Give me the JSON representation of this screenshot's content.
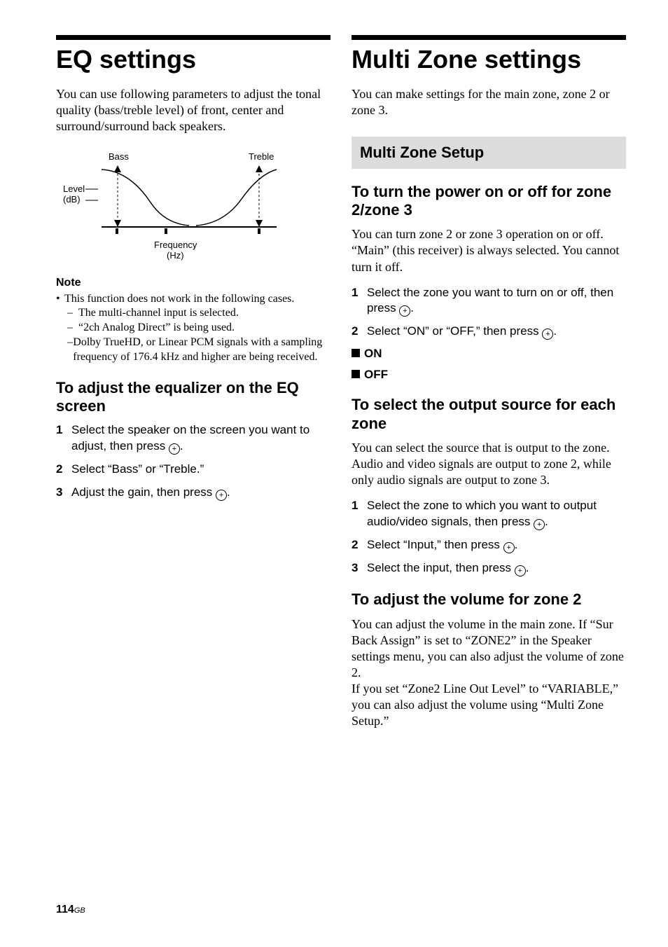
{
  "left": {
    "title": "EQ settings",
    "intro": "You can use following parameters to adjust the tonal quality (bass/treble level) of front, center and surround/surround back speakers.",
    "diagram": {
      "bass": "Bass",
      "treble": "Treble",
      "level": "Level",
      "db": "(dB)",
      "freq": "Frequency",
      "hz": "(Hz)"
    },
    "note_label": "Note",
    "note_bullet": "This function does not work in the following cases.",
    "note_items": [
      "The multi-channel input is selected.",
      "“2ch Analog Direct” is being used.",
      "Dolby TrueHD, or Linear PCM signals with a sampling frequency of 176.4 kHz and higher are being received."
    ],
    "adjust_heading": "To adjust the equalizer on the EQ screen",
    "steps": [
      {
        "pre": "Select the speaker on the screen you want to adjust, then press ",
        "post": "."
      },
      {
        "pre": "Select “Bass” or “Treble.”",
        "post": ""
      },
      {
        "pre": "Adjust the gain, then press ",
        "post": "."
      }
    ]
  },
  "right": {
    "title": "Multi Zone settings",
    "intro": "You can make settings for the main zone, zone 2 or zone 3.",
    "greybox": "Multi Zone Setup",
    "power_heading": "To turn the power on or off for zone 2/zone 3",
    "power_body": "You can turn zone 2 or zone 3 operation on or off. “Main” (this receiver) is always selected. You cannot turn it off.",
    "power_steps": [
      {
        "pre": "Select the zone you want to turn on or off, then press ",
        "post": "."
      },
      {
        "pre": "Select “ON” or “OFF,” then press ",
        "post": "."
      }
    ],
    "on_label": "ON",
    "off_label": "OFF",
    "source_heading": "To select the output source for each zone",
    "source_body": "You can select the source that is output to the zone. Audio and video signals are output to zone 2, while only audio signals are output to zone 3.",
    "source_steps": [
      {
        "pre": "Select the zone to which you want to output audio/video signals, then press ",
        "post": "."
      },
      {
        "pre": "Select “Input,” then press ",
        "post": "."
      },
      {
        "pre": "Select the input, then press ",
        "post": "."
      }
    ],
    "volume_heading": "To adjust the volume for zone 2",
    "volume_body": "You can adjust the volume in the main zone. If “Sur Back Assign” is set to “ZONE2” in the Speaker settings menu, you can also adjust the volume of zone 2.\nIf you set “Zone2 Line Out Level” to “VARIABLE,” you can also adjust the volume using “Multi Zone Setup.”"
  },
  "footer": {
    "page": "114",
    "gb": "GB"
  }
}
